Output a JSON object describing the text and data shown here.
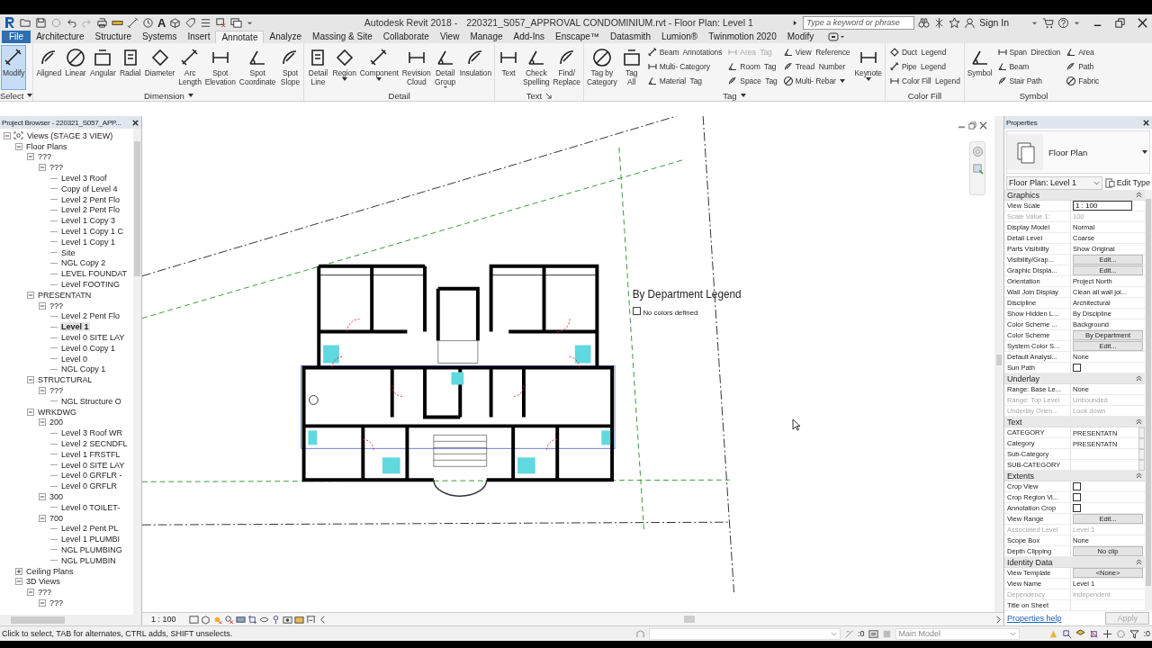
{
  "title_bar": {
    "text_tool": "A",
    "app": "Autodesk Revit 2018 -",
    "document": "220321_S057_APPROVAL CONDOMINIUM.rvt - Floor Plan: Level 1",
    "search_placeholder": "Type a keyword or phrase",
    "sign_in": "Sign In"
  },
  "tabs": [
    {
      "label": "File",
      "kind": "app",
      "selected": false
    },
    {
      "label": "Architecture",
      "kind": "tab",
      "selected": false
    },
    {
      "label": "Structure",
      "kind": "tab",
      "selected": false
    },
    {
      "label": "Systems",
      "kind": "tab",
      "selected": false
    },
    {
      "label": "Insert",
      "kind": "tab",
      "selected": false
    },
    {
      "label": "Annotate",
      "kind": "tab",
      "selected": true
    },
    {
      "label": "Analyze",
      "kind": "tab",
      "selected": false
    },
    {
      "label": "Massing & Site",
      "kind": "tab",
      "selected": false
    },
    {
      "label": "Collaborate",
      "kind": "tab",
      "selected": false
    },
    {
      "label": "View",
      "kind": "tab",
      "selected": false
    },
    {
      "label": "Manage",
      "kind": "tab",
      "selected": false
    },
    {
      "label": "Add-Ins",
      "kind": "tab",
      "selected": false
    },
    {
      "label": "Enscape™",
      "kind": "tab",
      "selected": false
    },
    {
      "label": "Datasmith",
      "kind": "tab",
      "selected": false
    },
    {
      "label": "Lumion®",
      "kind": "tab",
      "selected": false
    },
    {
      "label": "Twinmotion 2020",
      "kind": "tab",
      "selected": false
    },
    {
      "label": "Modify",
      "kind": "tab",
      "selected": false
    }
  ],
  "ribbon": {
    "panels": [
      {
        "title": "Select",
        "menu": true,
        "tools": [
          {
            "kind": "large",
            "label": "Modify",
            "selected": true,
            "dropdown": false
          }
        ]
      },
      {
        "title": "Dimension",
        "menu": true,
        "tools": [
          {
            "kind": "large",
            "label": "Aligned",
            "selected": false,
            "dropdown": false
          },
          {
            "kind": "large",
            "label": "Linear",
            "selected": false,
            "dropdown": false
          },
          {
            "kind": "large",
            "label": "Angular",
            "selected": false,
            "dropdown": false
          },
          {
            "kind": "large",
            "label": "Radial",
            "selected": false,
            "dropdown": false
          },
          {
            "kind": "large",
            "label": "Diameter",
            "selected": false,
            "dropdown": false
          },
          {
            "kind": "large",
            "label": "Arc\nLength",
            "selected": false,
            "dropdown": false
          },
          {
            "kind": "large",
            "label": "Spot\nElevation",
            "selected": false,
            "dropdown": false
          },
          {
            "kind": "large",
            "label": "Spot\nCoordinate",
            "selected": false,
            "dropdown": false
          },
          {
            "kind": "large",
            "label": "Spot\nSlope",
            "selected": false,
            "dropdown": false
          }
        ]
      },
      {
        "title": "Detail",
        "tools": [
          {
            "kind": "large",
            "label": "Detail\nLine",
            "selected": false,
            "dropdown": false
          },
          {
            "kind": "large",
            "label": "Region",
            "selected": false,
            "dropdown": true
          },
          {
            "kind": "large",
            "label": "Component",
            "selected": false,
            "dropdown": true
          },
          {
            "kind": "large",
            "label": "Revision\nCloud",
            "selected": false,
            "dropdown": false
          },
          {
            "kind": "large",
            "label": "Detail\nGroup",
            "selected": false,
            "dropdown": true
          },
          {
            "kind": "large",
            "label": "Insulation",
            "selected": false,
            "dropdown": false
          }
        ]
      },
      {
        "title": "Text",
        "launcher": true,
        "tools": [
          {
            "kind": "large",
            "label": "Text",
            "selected": false,
            "dropdown": false
          },
          {
            "kind": "large",
            "label": "Check\nSpelling",
            "selected": false,
            "dropdown": false
          },
          {
            "kind": "large",
            "label": "Find/\nReplace",
            "selected": false,
            "dropdown": false
          }
        ]
      },
      {
        "title": "Tag",
        "menu": true,
        "tools": [
          {
            "kind": "large",
            "label": "Tag by\nCategory",
            "selected": false,
            "dropdown": false
          },
          {
            "kind": "large",
            "label": "Tag\nAll",
            "selected": false,
            "dropdown": false
          },
          {
            "kind": "stack",
            "items": [
              {
                "label": "Beam  Annotations",
                "disabled": false,
                "dropdown": false
              },
              {
                "label": "Multi- Category",
                "disabled": false,
                "dropdown": false
              },
              {
                "label": "Material  Tag",
                "disabled": false,
                "dropdown": false
              }
            ]
          },
          {
            "kind": "stack",
            "items": [
              {
                "label": "Area  Tag",
                "disabled": true,
                "dropdown": false
              },
              {
                "label": "Room  Tag",
                "disabled": false,
                "dropdown": false
              },
              {
                "label": "Space  Tag",
                "disabled": false,
                "dropdown": false
              }
            ]
          },
          {
            "kind": "stack",
            "items": [
              {
                "label": "View  Reference",
                "disabled": false,
                "dropdown": false
              },
              {
                "label": "Tread  Number",
                "disabled": false,
                "dropdown": false
              },
              {
                "label": "Multi- Rebar",
                "disabled": false,
                "dropdown": true
              }
            ]
          },
          {
            "kind": "large",
            "label": "Keynote",
            "selected": false,
            "dropdown": true
          }
        ]
      },
      {
        "title": "Color Fill",
        "tools": [
          {
            "kind": "stack",
            "items": [
              {
                "label": "Duct  Legend",
                "disabled": false,
                "dropdown": false
              },
              {
                "label": "Pipe  Legend",
                "disabled": false,
                "dropdown": false
              },
              {
                "label": "Color Fill  Legend",
                "disabled": false,
                "dropdown": false
              }
            ]
          }
        ]
      },
      {
        "title": "Symbol",
        "tools": [
          {
            "kind": "large",
            "label": "Symbol",
            "selected": false,
            "dropdown": false
          },
          {
            "kind": "stack",
            "items": [
              {
                "label": "Span  Direction",
                "disabled": false,
                "dropdown": false
              },
              {
                "label": "Beam",
                "disabled": false,
                "dropdown": false
              },
              {
                "label": "Stair Path",
                "disabled": false,
                "dropdown": false
              }
            ]
          },
          {
            "kind": "stack",
            "items": [
              {
                "label": "Area",
                "disabled": false,
                "dropdown": false
              },
              {
                "label": "Path",
                "disabled": false,
                "dropdown": false
              },
              {
                "label": "Fabric",
                "disabled": false,
                "dropdown": false
              }
            ]
          }
        ]
      }
    ]
  },
  "browser": {
    "title": "Project Browser - 220321_S057_APP...",
    "items": [
      {
        "label": "Views (STAGE 3  VIEW)",
        "expanded": true,
        "selected": false,
        "children": [
          {
            "label": "Floor Plans",
            "expanded": true,
            "selected": false,
            "children": [
              {
                "label": "???",
                "expanded": true,
                "selected": false,
                "children": [
                  {
                    "label": "???",
                    "expanded": true,
                    "selected": false,
                    "children": [
                      {
                        "label": "Level 3 Roof",
                        "selected": false
                      },
                      {
                        "label": "Copy of Level 4",
                        "selected": false
                      },
                      {
                        "label": "Level 2 Pent Flo",
                        "selected": false
                      },
                      {
                        "label": "Level 2 Pent Flo",
                        "selected": false
                      },
                      {
                        "label": "Level 1 Copy 3",
                        "selected": false
                      },
                      {
                        "label": "Level 1 Copy 1 C",
                        "selected": false
                      },
                      {
                        "label": "Level 1 Copy 1",
                        "selected": false
                      },
                      {
                        "label": "Site",
                        "selected": false
                      },
                      {
                        "label": "NGL Copy 2",
                        "selected": false
                      },
                      {
                        "label": "LEVEL FOUNDAT",
                        "selected": false
                      },
                      {
                        "label": "Level FOOTING",
                        "selected": false
                      }
                    ]
                  }
                ]
              },
              {
                "label": "PRESENTATN",
                "expanded": true,
                "selected": false,
                "children": [
                  {
                    "label": "???",
                    "expanded": true,
                    "selected": false,
                    "children": [
                      {
                        "label": "Level 2 Pent Flo",
                        "selected": false
                      },
                      {
                        "label": "Level 1",
                        "selected": true
                      },
                      {
                        "label": "Level 0 SITE LAY",
                        "selected": false
                      },
                      {
                        "label": "Level 0 Copy 1",
                        "selected": false
                      },
                      {
                        "label": "Level 0",
                        "selected": false
                      },
                      {
                        "label": "NGL Copy 1",
                        "selected": false
                      }
                    ]
                  }
                ]
              },
              {
                "label": "STRUCTURAL",
                "expanded": true,
                "selected": false,
                "children": [
                  {
                    "label": "???",
                    "expanded": true,
                    "selected": false,
                    "children": [
                      {
                        "label": "NGL Structure O",
                        "selected": false
                      }
                    ]
                  }
                ]
              },
              {
                "label": "WRKDWG",
                "expanded": true,
                "selected": false,
                "children": [
                  {
                    "label": "200",
                    "expanded": true,
                    "selected": false,
                    "children": [
                      {
                        "label": "Level 3 Roof WR",
                        "selected": false
                      },
                      {
                        "label": "Level 2 SECNDFL",
                        "selected": false
                      },
                      {
                        "label": "Level 1 FRSTFL",
                        "selected": false
                      },
                      {
                        "label": "Level 0 SITE LAY",
                        "selected": false
                      },
                      {
                        "label": "Level 0 GRFLR -",
                        "selected": false
                      },
                      {
                        "label": "Level 0 GRFLR",
                        "selected": false
                      }
                    ]
                  },
                  {
                    "label": "300",
                    "expanded": true,
                    "selected": false,
                    "children": [
                      {
                        "label": "Level 0 TOILET-",
                        "selected": false
                      }
                    ]
                  },
                  {
                    "label": "700",
                    "expanded": true,
                    "selected": false,
                    "children": [
                      {
                        "label": "Level 2 Pent PL",
                        "selected": false
                      },
                      {
                        "label": "Level 1 PLUMBI",
                        "selected": false
                      },
                      {
                        "label": "NGL PLUMBING",
                        "selected": false
                      },
                      {
                        "label": "NGL PLUMBIN",
                        "selected": false
                      }
                    ]
                  }
                ]
              }
            ]
          },
          {
            "label": "Ceiling Plans",
            "expanded": false,
            "selected": false
          },
          {
            "label": "3D Views",
            "expanded": true,
            "selected": false,
            "children": [
              {
                "label": "???",
                "expanded": true,
                "selected": false,
                "children": [
                  {
                    "label": "???",
                    "expanded": true,
                    "selected": false
                  }
                ]
              }
            ]
          }
        ]
      }
    ]
  },
  "canvas": {
    "legend_title": "By Department Legend",
    "legend_note": "No colors defined"
  },
  "view_bar": {
    "scale": "1 : 100"
  },
  "properties": {
    "title": "Properties",
    "type": "Floor Plan",
    "instance": "Floor Plan: Level 1",
    "edit_type": "Edit Type",
    "sections": [
      {
        "title": "Graphics",
        "rows": [
          {
            "label": "View Scale",
            "value": "1 : 100",
            "kind": "input",
            "disabled": false
          },
          {
            "label": "Scale Value    1:",
            "value": "100",
            "kind": "text",
            "disabled": true
          },
          {
            "label": "Display Model",
            "value": "Normal",
            "kind": "text",
            "disabled": false
          },
          {
            "label": "Detail Level",
            "value": "Coarse",
            "kind": "text",
            "disabled": false
          },
          {
            "label": "Parts Visibility",
            "value": "Show Original",
            "kind": "text",
            "disabled": false
          },
          {
            "label": "Visibility/Grap...",
            "value": "Edit...",
            "kind": "button",
            "disabled": false
          },
          {
            "label": "Graphic Displa...",
            "value": "Edit...",
            "kind": "button",
            "disabled": false
          },
          {
            "label": "Orientation",
            "value": "Project North",
            "kind": "text",
            "disabled": false
          },
          {
            "label": "Wall Join Display",
            "value": "Clean all wall joi...",
            "kind": "text",
            "disabled": false
          },
          {
            "label": "Discipline",
            "value": "Architectural",
            "kind": "text",
            "disabled": false
          },
          {
            "label": "Show Hidden L...",
            "value": "By Discipline",
            "kind": "text",
            "disabled": false
          },
          {
            "label": "Color Scheme ...",
            "value": "Background",
            "kind": "text",
            "disabled": false
          },
          {
            "label": "Color Scheme",
            "value": "By Department",
            "kind": "button",
            "disabled": false
          },
          {
            "label": "System Color S...",
            "value": "Edit...",
            "kind": "button",
            "disabled": false
          },
          {
            "label": "Default Analysi...",
            "value": "None",
            "kind": "text",
            "disabled": false
          },
          {
            "label": "Sun Path",
            "kind": "checkbox",
            "checked": false,
            "disabled": false
          }
        ]
      },
      {
        "title": "Underlay",
        "rows": [
          {
            "label": "Range: Base Le...",
            "value": "None",
            "kind": "text",
            "disabled": false
          },
          {
            "label": "Range: Top Level",
            "value": "Unbounded",
            "kind": "text",
            "disabled": true
          },
          {
            "label": "Underlay Orien...",
            "value": "Look down",
            "kind": "text",
            "disabled": true
          }
        ]
      },
      {
        "title": "Text",
        "rows": [
          {
            "label": "CATEGORY",
            "value": "PRESENTATN",
            "kind": "param",
            "disabled": false
          },
          {
            "label": "Category",
            "value": "PRESENTATN",
            "kind": "param",
            "disabled": false
          },
          {
            "label": "Sub-Category",
            "kind": "param",
            "disabled": false
          },
          {
            "label": "SUB-CATEGORY",
            "kind": "param",
            "disabled": false
          }
        ]
      },
      {
        "title": "Extents",
        "rows": [
          {
            "label": "Crop View",
            "kind": "checkbox",
            "checked": false,
            "disabled": false
          },
          {
            "label": "Crop Region Vi...",
            "kind": "checkbox",
            "checked": false,
            "disabled": false
          },
          {
            "label": "Annotation Crop",
            "kind": "checkbox",
            "checked": false,
            "disabled": false
          },
          {
            "label": "View Range",
            "value": "Edit...",
            "kind": "button",
            "disabled": false
          },
          {
            "label": "Associated Level",
            "value": "Level 1",
            "kind": "text",
            "disabled": true
          },
          {
            "label": "Scope Box",
            "value": "None",
            "kind": "text",
            "disabled": false
          },
          {
            "label": "Depth Clipping",
            "value": "No clip",
            "kind": "button",
            "disabled": false
          }
        ]
      },
      {
        "title": "Identity Data",
        "rows": [
          {
            "label": "View Template",
            "value": "<None>",
            "kind": "button",
            "disabled": false
          },
          {
            "label": "View Name",
            "value": "Level 1",
            "kind": "text",
            "disabled": false
          },
          {
            "label": "Dependency",
            "value": "Independent",
            "kind": "text",
            "disabled": true
          },
          {
            "label": "Title on Sheet",
            "kind": "text",
            "disabled": false
          }
        ]
      }
    ],
    "help": "Properties help",
    "apply": "Apply",
    "apply_disabled": true
  },
  "status_bar": {
    "message": "Click to select, TAB for alternates, CTRL adds, SHIFT unselects.",
    "count_1": ":0",
    "workset": "Main Model",
    "filter_count": ":0"
  }
}
